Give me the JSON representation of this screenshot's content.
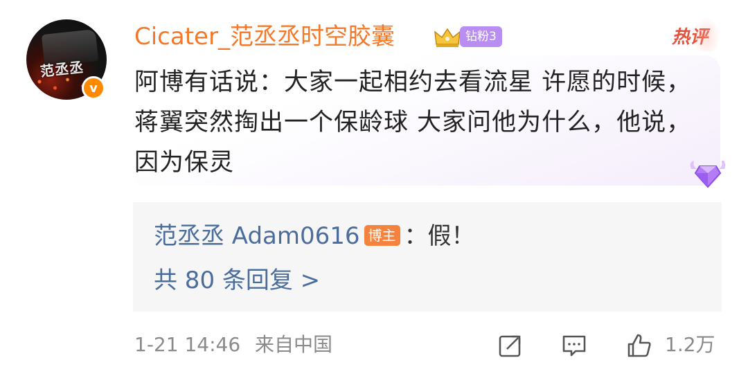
{
  "comment": {
    "username": "Cicater_范丞丞时空胶囊",
    "fan_badge": "钻粉3",
    "hot_tag": "热评",
    "text": "阿博有话说：大家一起相约去看流星 许愿的时候，蒋翼突然掏出一个保龄球 大家问他为什么，他说，因为保灵",
    "avatar_text": "范丞丞",
    "verified_mark": "v"
  },
  "reply": {
    "author": "范丞丞 Adam0616",
    "author_badge": "博主",
    "text": "：假！",
    "more_label": "共 80 条回复 >"
  },
  "meta": {
    "date": "1-21 14:46",
    "location": "来自中国",
    "like_count": "1.2万"
  },
  "icons": [
    "share-icon",
    "comment-icon",
    "like-icon",
    "crown-icon",
    "gem-icon"
  ],
  "colors": {
    "username": "#f2792a",
    "link": "#4a6d9c",
    "fan_badge": "#b98ef3",
    "host_badge": "#f5833e",
    "hot_tag": "#e8503b",
    "verified": "#ff8a00"
  }
}
